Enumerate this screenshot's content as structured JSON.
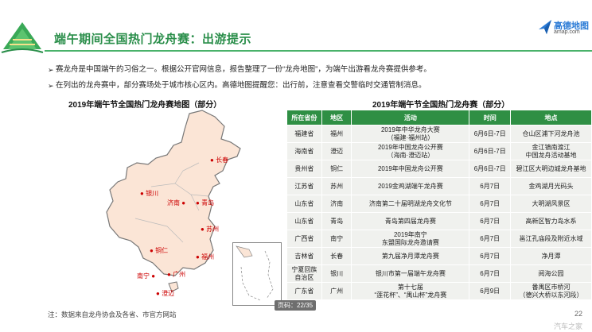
{
  "header": {
    "title": "端午期间全国热门龙舟赛：出游提示",
    "logo_main": "高德地图",
    "logo_sub": "amap.com"
  },
  "bullets": [
    "赛龙舟是中国端午的习俗之一。根据公开官网信息，报告整理了一份“龙舟地图”，为端午出游看龙舟赛提供参考。",
    "在列出的龙舟赛中，部分赛场处于城市核心区内。高德地图提醒您：出行前，注意查看交警临时交通管制消息。"
  ],
  "map": {
    "title": "2019年端午节全国热门龙舟赛地图（部分）",
    "cities": [
      "长春",
      "银川",
      "济南",
      "青岛",
      "苏州",
      "铜仁",
      "福州",
      "南宁",
      "广州",
      "澄迈"
    ],
    "pin_color": "#e0302a",
    "land_color": "#fbe5d6"
  },
  "table": {
    "title": "2019年端午节全国热门龙舟赛（部分）",
    "headers": [
      "所在省份",
      "地区",
      "活动",
      "时间",
      "地点"
    ],
    "rows": [
      {
        "province": "福建省",
        "area": "福州",
        "activity": [
          "2019年中华龙舟大赛",
          "（福建·福州站）"
        ],
        "time": "6月6日-7日",
        "place": [
          "仓山区浦下河龙舟池"
        ]
      },
      {
        "province": "海南省",
        "area": "澄迈",
        "activity": [
          "2019年中国龙舟公开赛",
          "（海南·澄迈站）"
        ],
        "time": "6月6日-7日",
        "place": [
          "金江镇南渡江",
          "中国龙舟活动基地"
        ]
      },
      {
        "province": "贵州省",
        "area": "铜仁",
        "activity": [
          "2019年中国龙舟公开赛"
        ],
        "time": "6月6日-7日",
        "place": [
          "碧江区大明边城龙舟基地"
        ]
      },
      {
        "province": "江苏省",
        "area": "苏州",
        "activity": [
          "2019金鸡湖端午龙舟赛"
        ],
        "time": "6月7日",
        "place": [
          "金鸡湖月光码头"
        ]
      },
      {
        "province": "山东省",
        "area": "济南",
        "activity": [
          "济南第二十届明湖龙舟文化节"
        ],
        "time": "6月7日",
        "place": [
          "大明湖风景区"
        ]
      },
      {
        "province": "山东省",
        "area": "青岛",
        "activity": [
          "青岛第四届龙舟赛"
        ],
        "time": "6月7日",
        "place": [
          "高新区智力岛水系"
        ]
      },
      {
        "province": "广西省",
        "area": "南宁",
        "activity": [
          "2019年南宁",
          "东盟国际龙舟邀请赛"
        ],
        "time": "6月7日",
        "place": [
          "邕江孔庙段及附近水域"
        ]
      },
      {
        "province": "吉林省",
        "area": "长春",
        "activity": [
          "第九届净月潭龙舟赛"
        ],
        "time": "6月7日",
        "place": [
          "净月潭"
        ]
      },
      {
        "province": [
          "宁夏回族",
          "自治区"
        ],
        "area": "银川",
        "activity": [
          "银川市第一届端午龙舟赛"
        ],
        "time": "6月7日",
        "place": [
          "阅海公园"
        ]
      },
      {
        "province": "广东省",
        "area": "广州",
        "activity": [
          "第十七届",
          "“莲花杯”、“禺山杯”龙舟赛"
        ],
        "time": "6月9日",
        "place": [
          "番禺区市桥河",
          "（德兴大桥以东河段）"
        ]
      }
    ]
  },
  "footer": {
    "note": "注：数据来自龙舟协会及各省、市官方网站",
    "page_badge": "页码：22/35",
    "page_number": "22",
    "watermark": "汽车之家"
  },
  "colors": {
    "accent": "#2a8e4a",
    "table_header": "#2f8f44",
    "row_bg": "#f0f1ee"
  }
}
